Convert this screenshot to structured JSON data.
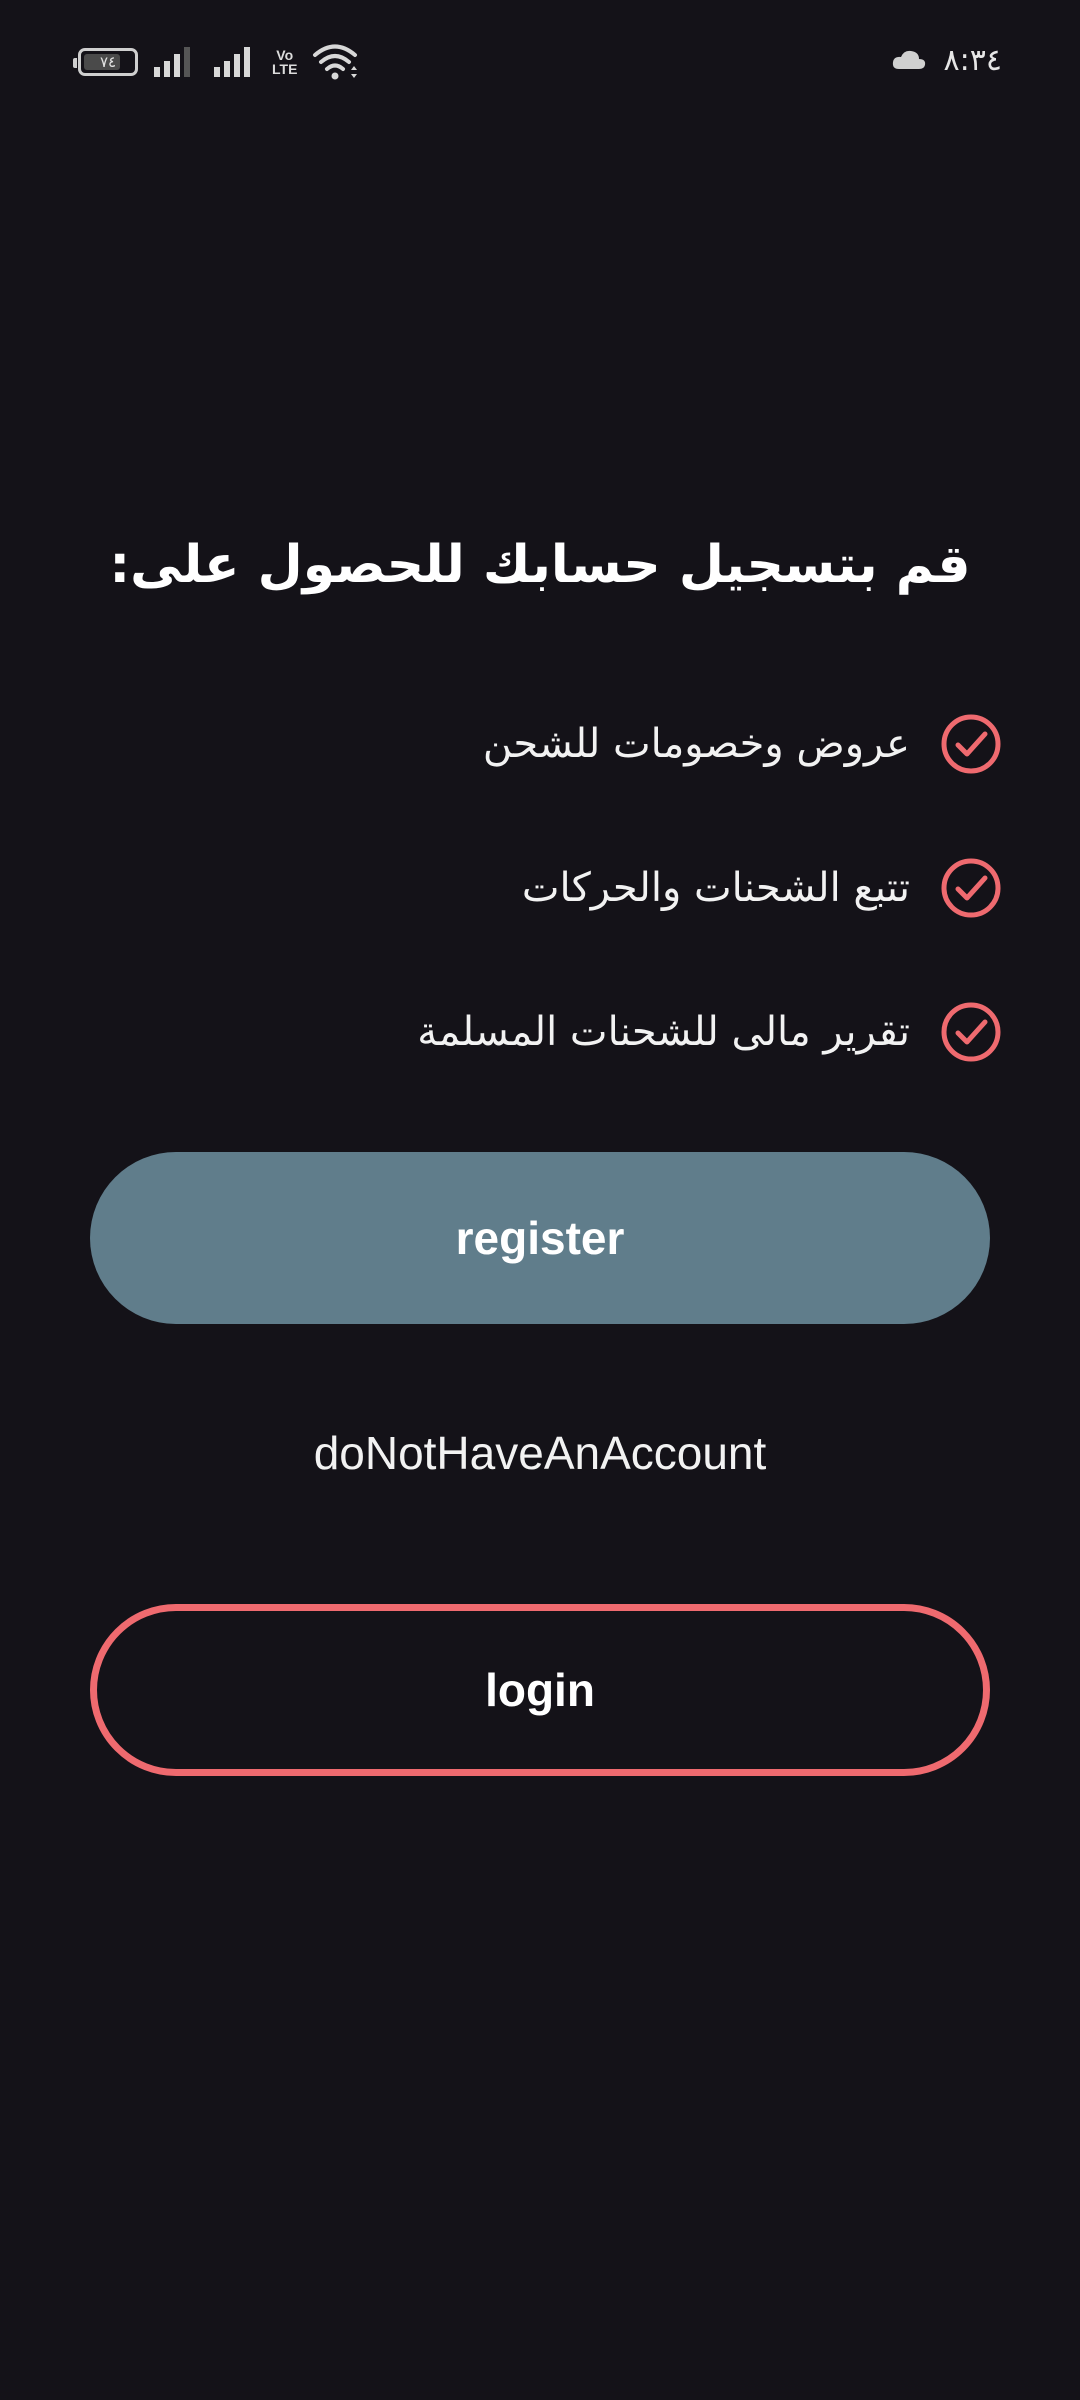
{
  "status_bar": {
    "battery_level": "٧٤",
    "battery_fraction": 0.74,
    "volte_top": "Vo",
    "volte_bottom": "LTE",
    "time": "٨:٣٤",
    "icons": [
      "battery-icon",
      "signal-icon",
      "signal-icon",
      "volte-icon",
      "wifi-icon",
      "cloud-icon"
    ]
  },
  "headline": "قم بتسجيل حسابك للحصول على:",
  "benefits": [
    {
      "label": "عروض وخصومات للشحن",
      "icon": "check-circle-icon"
    },
    {
      "label": "تتبع الشحنات والحركات",
      "icon": "check-circle-icon"
    },
    {
      "label": "تقرير مالى للشحنات المسلمة",
      "icon": "check-circle-icon"
    }
  ],
  "buttons": {
    "register_label": "register",
    "login_label": "login"
  },
  "no_account_text": "doNotHaveAnAccount",
  "colors": {
    "background": "#141218",
    "accent": "#ef6a6f",
    "register_button": "#607d8b",
    "text": "#ffffff"
  }
}
